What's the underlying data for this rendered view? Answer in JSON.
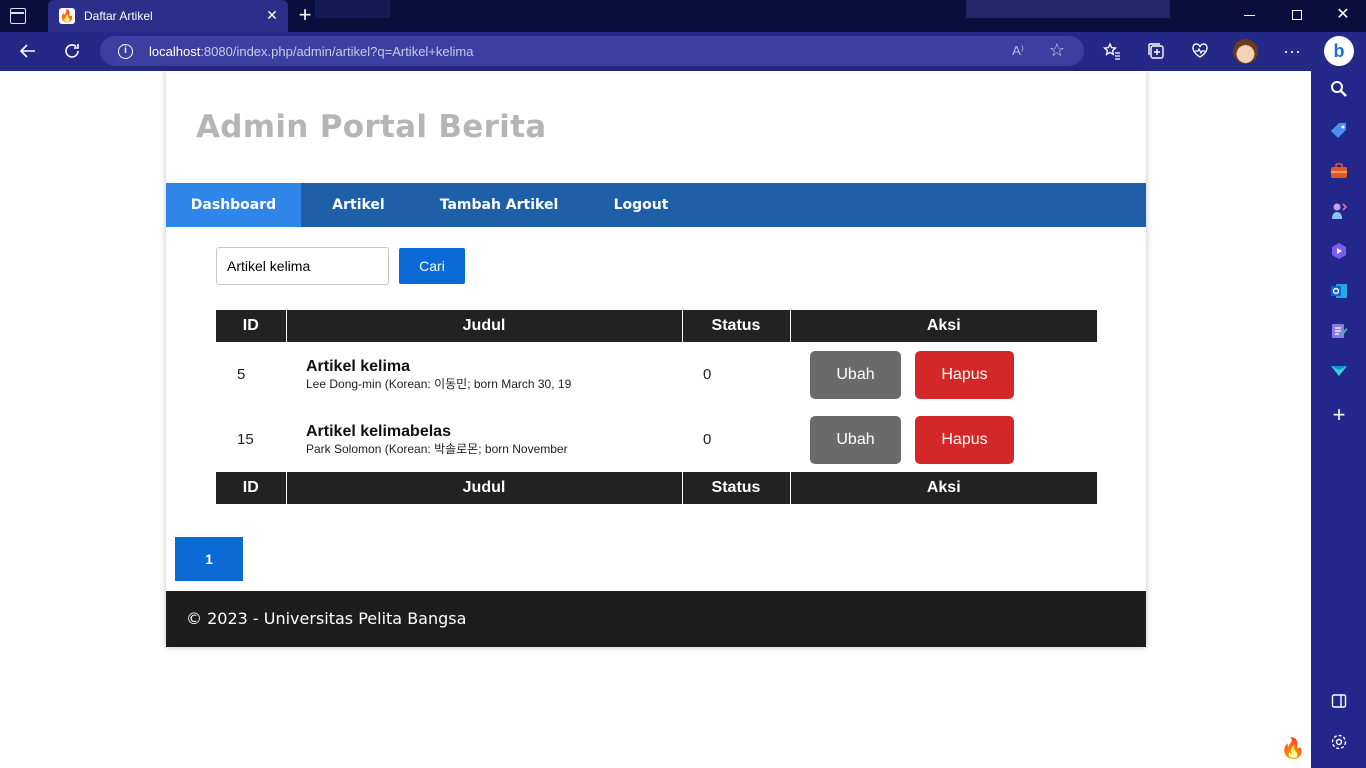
{
  "browser": {
    "tab_title": "Daftar Artikel",
    "tab_close": "✕",
    "new_tab": "+",
    "url_host": "localhost",
    "url_rest": ":8080/index.php/admin/artikel?q=Artikel+kelima",
    "window_controls": {
      "close": "✕"
    },
    "toolbar_icons": [
      "back-icon",
      "refresh-icon",
      "info-icon",
      "read-aloud-icon",
      "favorite-star-icon",
      "favorites-icon",
      "collections-icon",
      "health-icon",
      "profile-avatar",
      "more-icon",
      "bing-icon"
    ],
    "more_label": "···",
    "read_label": "A⁾"
  },
  "sidebar": {
    "icons": [
      "search-icon",
      "tag-icon",
      "briefcase-icon",
      "chess-icon",
      "copilot-icon",
      "outlook-icon",
      "notes-icon",
      "send-icon",
      "add-icon",
      "layout-icon",
      "settings-icon"
    ]
  },
  "site": {
    "title": "Admin Portal Berita",
    "nav": [
      {
        "label": "Dashboard",
        "active": true
      },
      {
        "label": "Artikel"
      },
      {
        "label": "Tambah Artikel"
      },
      {
        "label": "Logout"
      }
    ]
  },
  "search": {
    "value": "Artikel kelima",
    "button_label": "Cari"
  },
  "table": {
    "headers": [
      "ID",
      "Judul",
      "Status",
      "Aksi"
    ],
    "rows": [
      {
        "id": "5",
        "title": "Artikel kelima",
        "excerpt": "Lee Dong-min (Korean: 이동민; born March 30, 19",
        "status": "0",
        "edit_label": "Ubah",
        "delete_label": "Hapus"
      },
      {
        "id": "15",
        "title": "Artikel kelimabelas",
        "excerpt": "Park Solomon (Korean: 박솔로몬; born November",
        "status": "0",
        "edit_label": "Ubah",
        "delete_label": "Hapus"
      }
    ]
  },
  "pagination": {
    "current": "1"
  },
  "footer": {
    "text": "© 2023 - Universitas Pelita Bangsa"
  },
  "colors": {
    "titlebar": "#0b0d3d",
    "toolbar": "#242887",
    "navbar": "#1f5fa8",
    "nav_active": "#2f86e8",
    "primary_button": "#0a6ad6",
    "edit_button": "#6a6a6a",
    "delete_button": "#d42828",
    "table_header": "#222222",
    "footer": "#1d1d1d"
  }
}
